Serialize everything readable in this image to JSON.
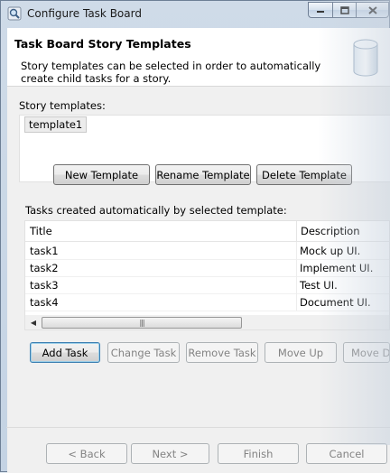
{
  "window": {
    "title": "Configure Task Board",
    "icon": "magnifier-icon",
    "controls": [
      "minimize-icon",
      "maximize-icon",
      "close-icon"
    ]
  },
  "header": {
    "title": "Task Board Story Templates",
    "description": "Story templates can be selected in order to automatically create child tasks for a story.",
    "icon": "database-icon"
  },
  "templates": {
    "label": "Story templates:",
    "items": [
      "template1"
    ],
    "buttons": {
      "new": "New Template",
      "rename": "Rename Template",
      "delete": "Delete Template"
    }
  },
  "tasks": {
    "label": "Tasks created automatically by selected template:",
    "columns": [
      "Title",
      "Description"
    ],
    "rows": [
      {
        "title": "task1",
        "description": "Mock up UI."
      },
      {
        "title": "task2",
        "description": "Implement UI."
      },
      {
        "title": "task3",
        "description": "Test UI."
      },
      {
        "title": "task4",
        "description": "Document UI."
      }
    ],
    "buttons": {
      "add": "Add Task",
      "change": "Change Task",
      "remove": "Remove Task",
      "up": "Move Up",
      "down": "Move D"
    }
  },
  "footer": {
    "back": "< Back",
    "next": "Next >",
    "finish": "Finish",
    "cancel": "Cancel"
  }
}
